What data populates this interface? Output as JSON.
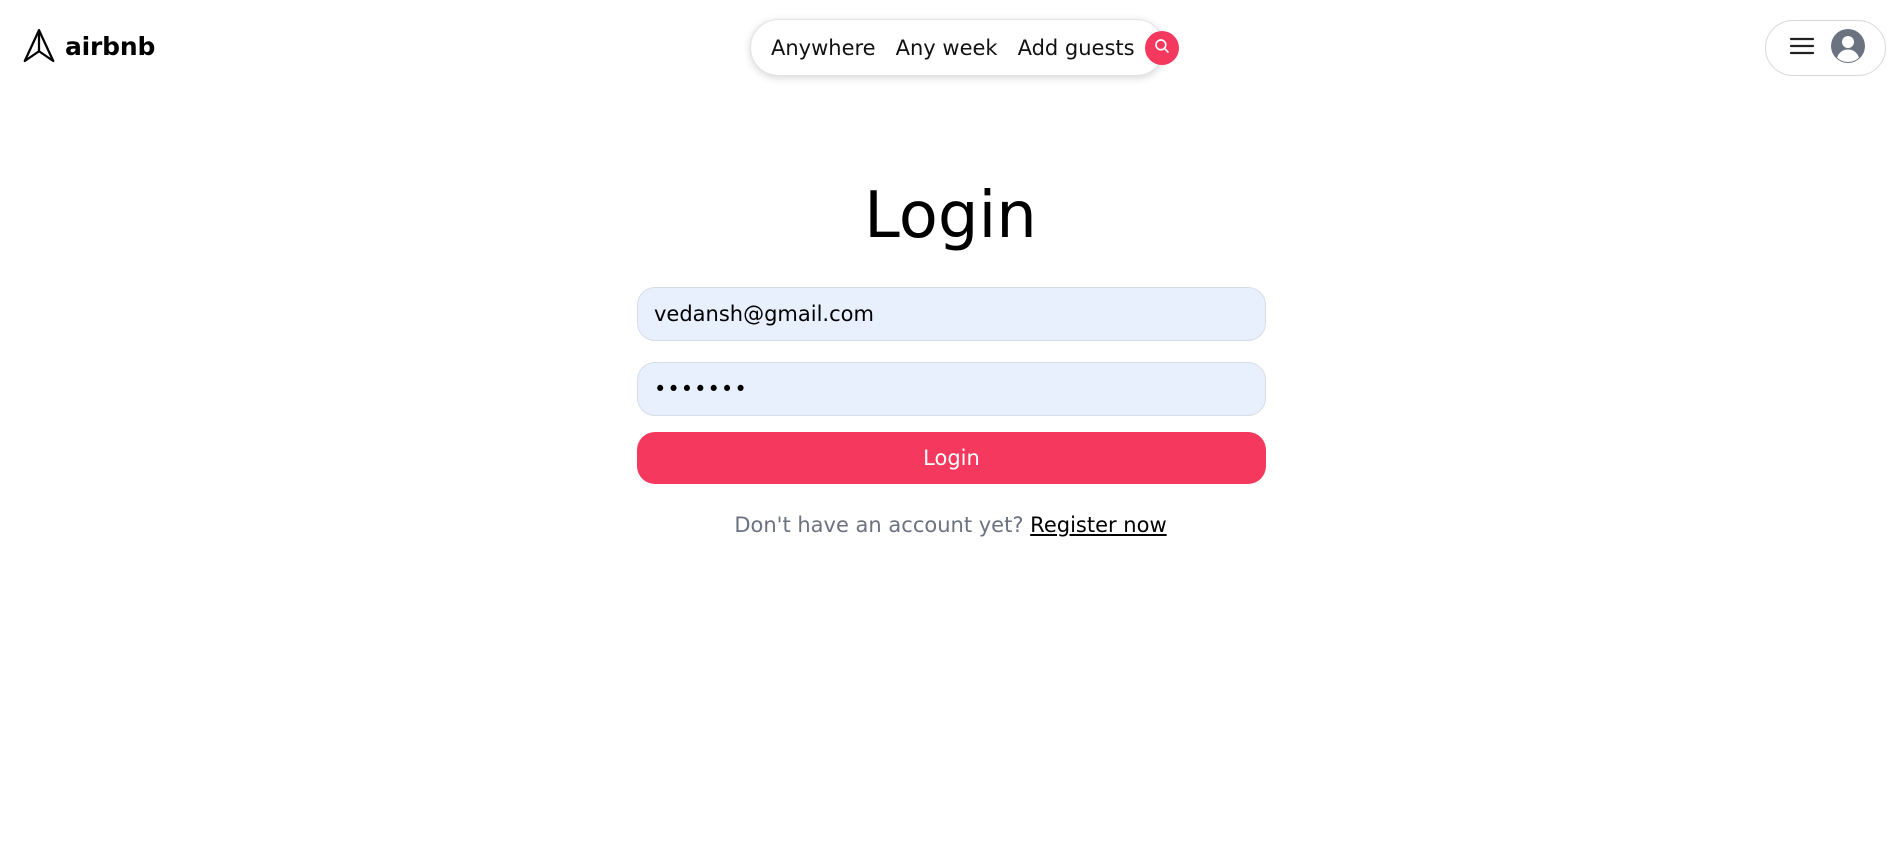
{
  "header": {
    "logo": {
      "icon": "paper-plane-icon",
      "text": "airbnb"
    },
    "search": {
      "location": "Anywhere",
      "dates": "Any week",
      "guests": "Add guests",
      "button_icon": "search-icon"
    },
    "user_menu": {
      "menu_icon": "hamburger-menu-icon",
      "avatar_icon": "user-avatar-icon"
    }
  },
  "login": {
    "title": "Login",
    "email_value": "vedansh@gmail.com",
    "password_value": "1234567",
    "submit_label": "Login",
    "register_prompt": "Don't have an account yet?",
    "register_link": "Register now"
  },
  "colors": {
    "brand": "#F5385D",
    "input_bg": "#E8F0FE",
    "muted_text": "#6b7280"
  }
}
